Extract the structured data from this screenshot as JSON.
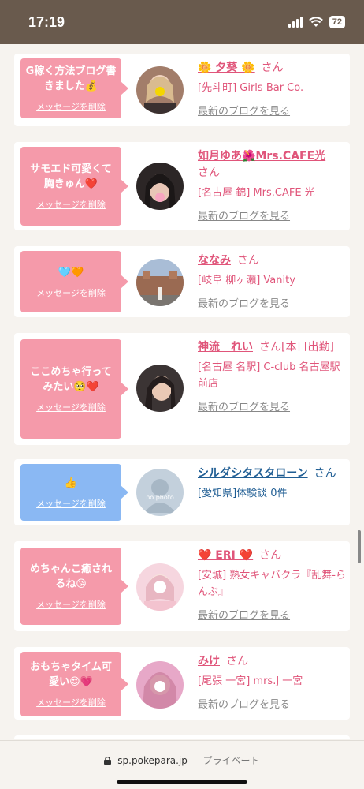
{
  "status_bar": {
    "time": "17:19",
    "battery": "72"
  },
  "browser": {
    "url": "sp.pokepara.jp",
    "privacy": "— プライベート"
  },
  "delete_label": "メッセージを削除",
  "blog_label": "最新のブログを見る",
  "san": "さん",
  "cards": [
    {
      "message": "G稼く方法ブログ書きました💰",
      "name": "🌼 夕葵 🌼",
      "shop": "[先斗町] Girls Bar Co.",
      "color": "pink"
    },
    {
      "message": "サモエド可愛くて胸きゅん❤️",
      "name": "如月ゆあ🌺Mrs.CAFE光",
      "shop": "[名古屋 錦] Mrs.CAFE 光",
      "color": "pink"
    },
    {
      "message": "🩵🧡",
      "name": "ななみ",
      "shop": "[岐阜 柳ヶ瀬] Vanity",
      "color": "pink"
    },
    {
      "message": "ここめちゃ行ってみたい🥺❤️",
      "name": "神流　れい",
      "name_suffix": "さん[本日出勤]",
      "shop": "[名古屋 名駅] C-club 名古屋駅前店",
      "color": "pink"
    },
    {
      "message": "👍",
      "name": "シルダシタスタローン",
      "shop": "[愛知県]体験談 0件",
      "color": "blue",
      "avatar_label": "no photo"
    },
    {
      "message": "めちゃんこ癒されるね😘",
      "name": "❤️ ERI ❤️",
      "shop": "[安城] 熟女キャバクラ『乱舞-らんぶ』",
      "color": "pink"
    },
    {
      "message": "おもちゃタイム可愛い😍💗",
      "name": "みけ",
      "shop": "[尾張 一宮] mrs.J 一宮",
      "color": "pink"
    }
  ],
  "colors": {
    "pink_bubble": "#f59aaa",
    "blue_bubble": "#8ab8f3",
    "name_pink": "#e0557a",
    "name_blue": "#1f5d93",
    "status_bg": "#695a4d"
  }
}
